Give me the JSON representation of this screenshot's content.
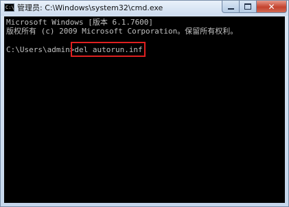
{
  "window": {
    "title": "管理员: C:\\Windows\\system32\\cmd.exe",
    "icon": "cmd-app-icon",
    "icon_glyph": "C:\\",
    "controls": {
      "minimize_icon": "minimize-icon",
      "maximize_icon": "maximize-icon",
      "close_icon": "close-icon",
      "close_glyph": "✕"
    }
  },
  "console": {
    "line1": "Microsoft Windows [版本 6.1.7600]",
    "line2": "版权所有 (c) 2009 Microsoft Corporation。保留所有权利。",
    "prompt": "C:\\Users\\admin>",
    "command": "del autorun.inf",
    "background_color": "#000000",
    "text_color": "#c0c0c0"
  },
  "annotation": {
    "highlight_color": "#e02020"
  }
}
